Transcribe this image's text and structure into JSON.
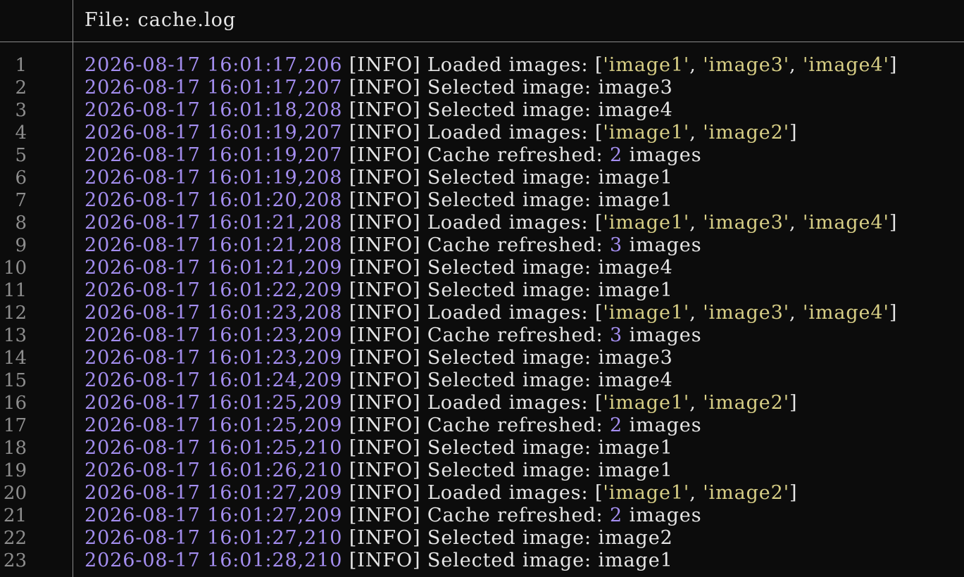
{
  "header": {
    "title": "File: cache.log"
  },
  "colors": {
    "background": "#0c0c0c",
    "text": "#e6e6e6",
    "timestamp": "#a48ef0",
    "string": "#d8cf86",
    "number": "#a48ef0",
    "line_number": "#8e8e8e"
  },
  "lines": [
    {
      "n": "1",
      "segments": [
        {
          "t": "2026-08-17 16:01:17,206",
          "c": "ts"
        },
        {
          "t": " [INFO] Loaded images: [",
          "c": "msg"
        },
        {
          "t": "'image1'",
          "c": "str"
        },
        {
          "t": ", ",
          "c": "msg"
        },
        {
          "t": "'image3'",
          "c": "str"
        },
        {
          "t": ", ",
          "c": "msg"
        },
        {
          "t": "'image4'",
          "c": "str"
        },
        {
          "t": "]",
          "c": "msg"
        }
      ]
    },
    {
      "n": "2",
      "segments": [
        {
          "t": "2026-08-17 16:01:17,207",
          "c": "ts"
        },
        {
          "t": " [INFO] Selected image: image3",
          "c": "msg"
        }
      ]
    },
    {
      "n": "3",
      "segments": [
        {
          "t": "2026-08-17 16:01:18,208",
          "c": "ts"
        },
        {
          "t": " [INFO] Selected image: image4",
          "c": "msg"
        }
      ]
    },
    {
      "n": "4",
      "segments": [
        {
          "t": "2026-08-17 16:01:19,207",
          "c": "ts"
        },
        {
          "t": " [INFO] Loaded images: [",
          "c": "msg"
        },
        {
          "t": "'image1'",
          "c": "str"
        },
        {
          "t": ", ",
          "c": "msg"
        },
        {
          "t": "'image2'",
          "c": "str"
        },
        {
          "t": "]",
          "c": "msg"
        }
      ]
    },
    {
      "n": "5",
      "segments": [
        {
          "t": "2026-08-17 16:01:19,207",
          "c": "ts"
        },
        {
          "t": " [INFO] Cache refreshed: ",
          "c": "msg"
        },
        {
          "t": "2",
          "c": "num"
        },
        {
          "t": " images",
          "c": "msg"
        }
      ]
    },
    {
      "n": "6",
      "segments": [
        {
          "t": "2026-08-17 16:01:19,208",
          "c": "ts"
        },
        {
          "t": " [INFO] Selected image: image1",
          "c": "msg"
        }
      ]
    },
    {
      "n": "7",
      "segments": [
        {
          "t": "2026-08-17 16:01:20,208",
          "c": "ts"
        },
        {
          "t": " [INFO] Selected image: image1",
          "c": "msg"
        }
      ]
    },
    {
      "n": "8",
      "segments": [
        {
          "t": "2026-08-17 16:01:21,208",
          "c": "ts"
        },
        {
          "t": " [INFO] Loaded images: [",
          "c": "msg"
        },
        {
          "t": "'image1'",
          "c": "str"
        },
        {
          "t": ", ",
          "c": "msg"
        },
        {
          "t": "'image3'",
          "c": "str"
        },
        {
          "t": ", ",
          "c": "msg"
        },
        {
          "t": "'image4'",
          "c": "str"
        },
        {
          "t": "]",
          "c": "msg"
        }
      ]
    },
    {
      "n": "9",
      "segments": [
        {
          "t": "2026-08-17 16:01:21,208",
          "c": "ts"
        },
        {
          "t": " [INFO] Cache refreshed: ",
          "c": "msg"
        },
        {
          "t": "3",
          "c": "num"
        },
        {
          "t": " images",
          "c": "msg"
        }
      ]
    },
    {
      "n": "10",
      "segments": [
        {
          "t": "2026-08-17 16:01:21,209",
          "c": "ts"
        },
        {
          "t": " [INFO] Selected image: image4",
          "c": "msg"
        }
      ]
    },
    {
      "n": "11",
      "segments": [
        {
          "t": "2026-08-17 16:01:22,209",
          "c": "ts"
        },
        {
          "t": " [INFO] Selected image: image1",
          "c": "msg"
        }
      ]
    },
    {
      "n": "12",
      "segments": [
        {
          "t": "2026-08-17 16:01:23,208",
          "c": "ts"
        },
        {
          "t": " [INFO] Loaded images: [",
          "c": "msg"
        },
        {
          "t": "'image1'",
          "c": "str"
        },
        {
          "t": ", ",
          "c": "msg"
        },
        {
          "t": "'image3'",
          "c": "str"
        },
        {
          "t": ", ",
          "c": "msg"
        },
        {
          "t": "'image4'",
          "c": "str"
        },
        {
          "t": "]",
          "c": "msg"
        }
      ]
    },
    {
      "n": "13",
      "segments": [
        {
          "t": "2026-08-17 16:01:23,209",
          "c": "ts"
        },
        {
          "t": " [INFO] Cache refreshed: ",
          "c": "msg"
        },
        {
          "t": "3",
          "c": "num"
        },
        {
          "t": " images",
          "c": "msg"
        }
      ]
    },
    {
      "n": "14",
      "segments": [
        {
          "t": "2026-08-17 16:01:23,209",
          "c": "ts"
        },
        {
          "t": " [INFO] Selected image: image3",
          "c": "msg"
        }
      ]
    },
    {
      "n": "15",
      "segments": [
        {
          "t": "2026-08-17 16:01:24,209",
          "c": "ts"
        },
        {
          "t": " [INFO] Selected image: image4",
          "c": "msg"
        }
      ]
    },
    {
      "n": "16",
      "segments": [
        {
          "t": "2026-08-17 16:01:25,209",
          "c": "ts"
        },
        {
          "t": " [INFO] Loaded images: [",
          "c": "msg"
        },
        {
          "t": "'image1'",
          "c": "str"
        },
        {
          "t": ", ",
          "c": "msg"
        },
        {
          "t": "'image2'",
          "c": "str"
        },
        {
          "t": "]",
          "c": "msg"
        }
      ]
    },
    {
      "n": "17",
      "segments": [
        {
          "t": "2026-08-17 16:01:25,209",
          "c": "ts"
        },
        {
          "t": " [INFO] Cache refreshed: ",
          "c": "msg"
        },
        {
          "t": "2",
          "c": "num"
        },
        {
          "t": " images",
          "c": "msg"
        }
      ]
    },
    {
      "n": "18",
      "segments": [
        {
          "t": "2026-08-17 16:01:25,210",
          "c": "ts"
        },
        {
          "t": " [INFO] Selected image: image1",
          "c": "msg"
        }
      ]
    },
    {
      "n": "19",
      "segments": [
        {
          "t": "2026-08-17 16:01:26,210",
          "c": "ts"
        },
        {
          "t": " [INFO] Selected image: image1",
          "c": "msg"
        }
      ]
    },
    {
      "n": "20",
      "segments": [
        {
          "t": "2026-08-17 16:01:27,209",
          "c": "ts"
        },
        {
          "t": " [INFO] Loaded images: [",
          "c": "msg"
        },
        {
          "t": "'image1'",
          "c": "str"
        },
        {
          "t": ", ",
          "c": "msg"
        },
        {
          "t": "'image2'",
          "c": "str"
        },
        {
          "t": "]",
          "c": "msg"
        }
      ]
    },
    {
      "n": "21",
      "segments": [
        {
          "t": "2026-08-17 16:01:27,209",
          "c": "ts"
        },
        {
          "t": " [INFO] Cache refreshed: ",
          "c": "msg"
        },
        {
          "t": "2",
          "c": "num"
        },
        {
          "t": " images",
          "c": "msg"
        }
      ]
    },
    {
      "n": "22",
      "segments": [
        {
          "t": "2026-08-17 16:01:27,210",
          "c": "ts"
        },
        {
          "t": " [INFO] Selected image: image2",
          "c": "msg"
        }
      ]
    },
    {
      "n": "23",
      "segments": [
        {
          "t": "2026-08-17 16:01:28,210",
          "c": "ts"
        },
        {
          "t": " [INFO] Selected image: image1",
          "c": "msg"
        }
      ]
    }
  ]
}
